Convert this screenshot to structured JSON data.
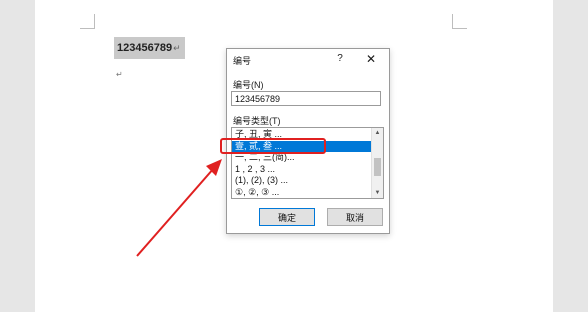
{
  "document": {
    "selected_text": "123456789",
    "para_mark": "↵",
    "empty_para_mark": "↵"
  },
  "dialog": {
    "title": "编号",
    "help_label": "?",
    "close_label": "✕",
    "number_label": "编号(N)",
    "number_value": "123456789",
    "type_label": "编号类型(T)",
    "types": [
      "子, 丑, 寅 ...",
      "壹, 贰, 叁 ...",
      "一, 二, 三(简)...",
      "1 , 2 , 3 ...",
      "(1), (2), (3) ...",
      "①, ②, ③ ..."
    ],
    "selected_type_index": 1,
    "ok_label": "确定",
    "cancel_label": "取消"
  },
  "colors": {
    "selection_blue": "#0078d7",
    "annotation_red": "#e02020"
  },
  "icons": {
    "scroll_up": "▲",
    "scroll_down": "▼"
  }
}
